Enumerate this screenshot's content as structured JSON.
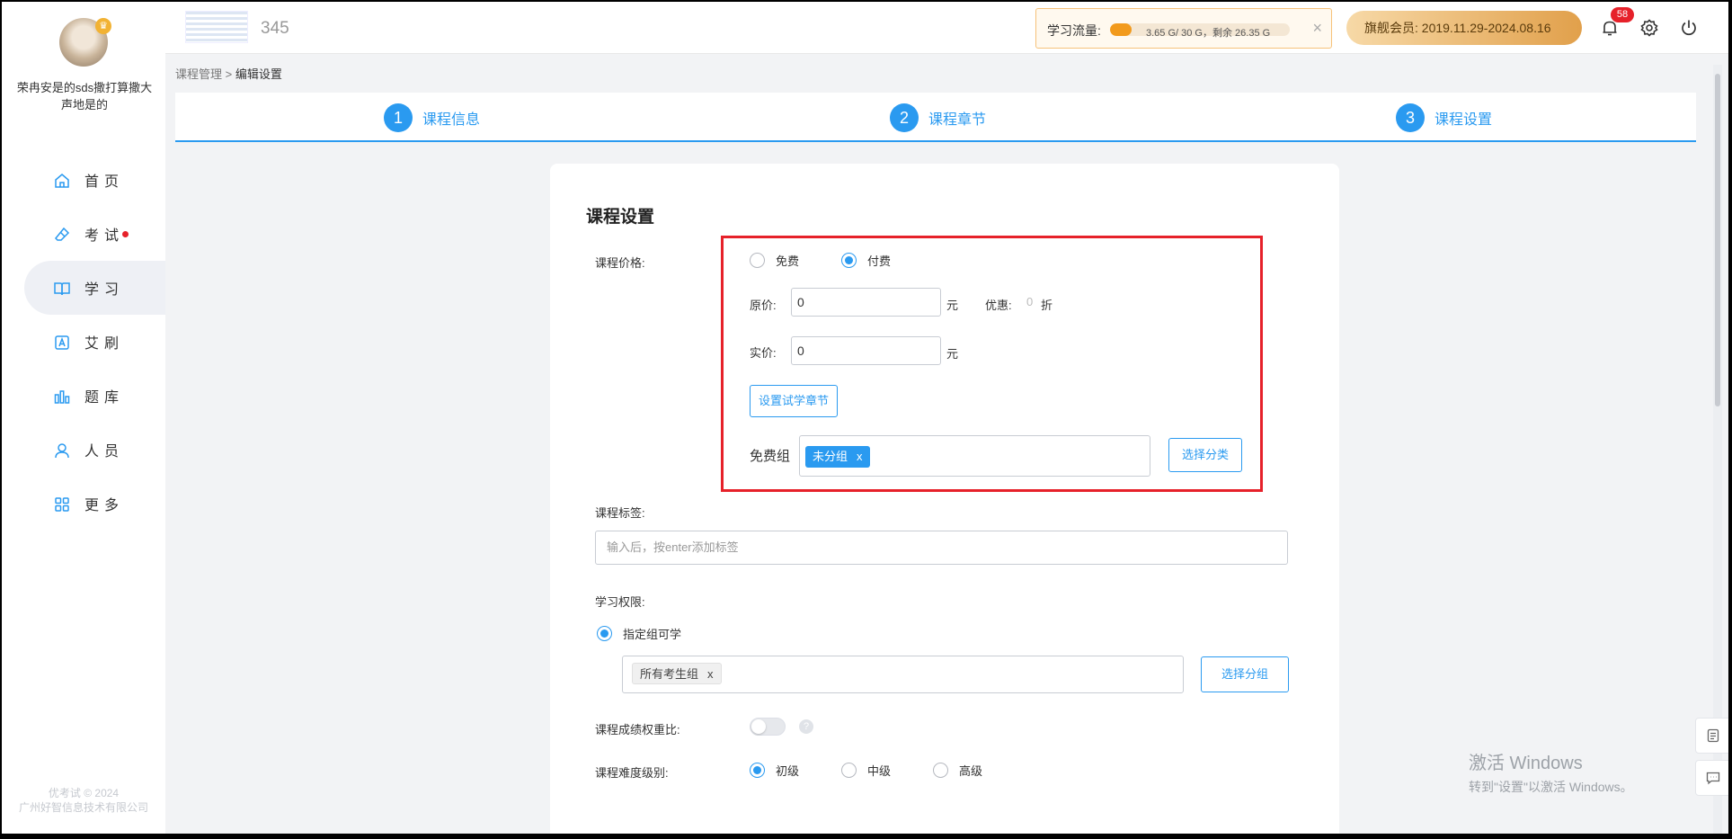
{
  "user": {
    "name": "荣冉安是的sds撒打算撒大声地是的",
    "badge_icon": "crown-icon"
  },
  "sidebar": {
    "items": [
      {
        "label": "首页",
        "icon": "home-icon"
      },
      {
        "label": "考试",
        "icon": "eraser-icon",
        "dot": true
      },
      {
        "label": "学习",
        "icon": "book-icon",
        "active": true
      },
      {
        "label": "艾刷",
        "icon": "letter-a-icon"
      },
      {
        "label": "题库",
        "icon": "bars-icon"
      },
      {
        "label": "人员",
        "icon": "person-icon"
      },
      {
        "label": "更多",
        "icon": "grid-icon"
      }
    ],
    "copyright_line1": "优考试 © 2024",
    "copyright_line2": "广州好智信息技术有限公司"
  },
  "topbar": {
    "number": "345",
    "flow_label": "学习流量:",
    "flow_text": "3.65 G/ 30 G，剩余 26.35 G",
    "flow_progress_percent": 12.2,
    "flow_close": "×",
    "vip_text": "旗舰会员: 2019.11.29-2024.08.16",
    "notifications": "58"
  },
  "breadcrumb": {
    "parent": "课程管理",
    "sep": ">",
    "current": "编辑设置"
  },
  "steps": [
    {
      "num": "1",
      "label": "课程信息"
    },
    {
      "num": "2",
      "label": "课程章节"
    },
    {
      "num": "3",
      "label": "课程设置"
    }
  ],
  "form": {
    "title": "课程设置",
    "price_label": "课程价格:",
    "free_option": "免费",
    "paid_option": "付费",
    "original_label": "原价:",
    "original_value": "0",
    "unit_yuan": "元",
    "discount_label": "优惠:",
    "discount_value": "0",
    "discount_unit": "折",
    "actual_label": "实价:",
    "actual_value": "0",
    "trial_button": "设置试学章节",
    "free_group_label": "免费组",
    "free_group_tag": "未分组",
    "tag_remove": "x",
    "choose_category_button": "选择分类",
    "tags_label": "课程标签:",
    "tags_placeholder": "输入后，按enter添加标签",
    "permission_label": "学习权限:",
    "permission_option": "指定组可学",
    "permission_group_tag": "所有考生组",
    "choose_group_button": "选择分组",
    "weight_label": "课程成绩权重比:",
    "help_mark": "?",
    "difficulty_label": "课程难度级别:",
    "difficulty_options": [
      "初级",
      "中级",
      "高级"
    ]
  },
  "watermark": {
    "line1": "激活 Windows",
    "line2": "转到\"设置\"以激活 Windows。"
  },
  "colors": {
    "accent": "#2a9af0",
    "highlight": "#e6212a",
    "vip": "#e1a04b"
  }
}
